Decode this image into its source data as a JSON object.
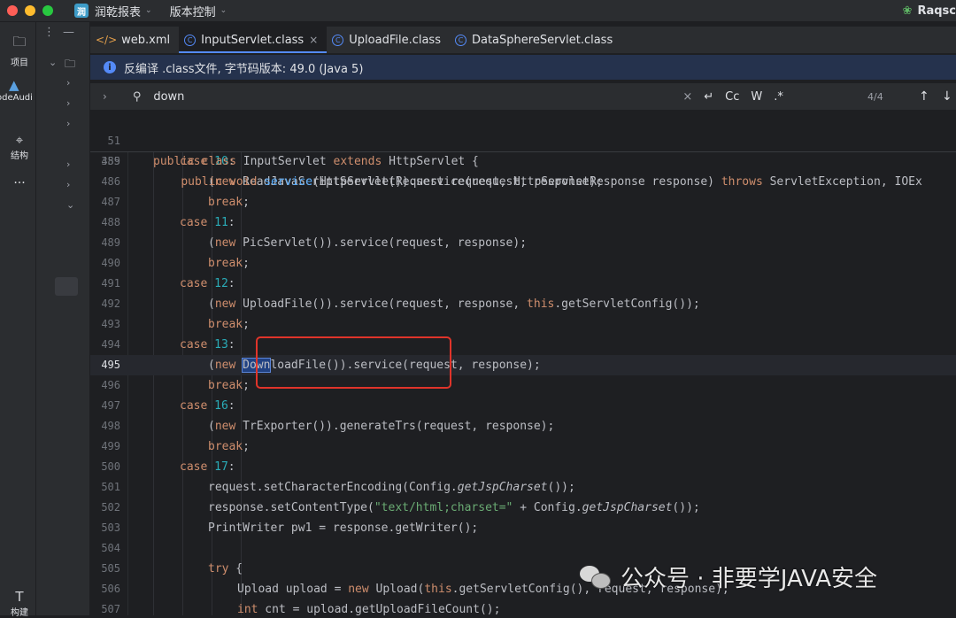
{
  "titlebar": {
    "project_badge": "润",
    "project_name": "润乾报表",
    "vcs_label": "版本控制",
    "user": "Raqsc"
  },
  "toolstrip": {
    "project_label": "项目",
    "codeaudit_label": "odeAudi",
    "structure_label": "结构",
    "more_label": "···",
    "build_label": "构建"
  },
  "tabs": [
    {
      "label": "web.xml",
      "icon": "xml-file-icon",
      "active": false
    },
    {
      "label": "InputServlet.class",
      "icon": "class-file-icon",
      "active": true
    },
    {
      "label": "UploadFile.class",
      "icon": "class-file-icon",
      "active": false
    },
    {
      "label": "DataSphereServlet.class",
      "icon": "class-file-icon",
      "active": false
    }
  ],
  "banner": {
    "text": "反编译 .class文件, 字节码版本: 49.0 (Java 5)"
  },
  "search": {
    "query": "down",
    "opt_case": "Cc",
    "opt_word": "W",
    "opt_regex": ".*",
    "match_count": "4/4"
  },
  "sticky_lines": [
    {
      "n": "51",
      "code": "public class InputServlet extends HttpServlet {"
    },
    {
      "n": "359",
      "code": "    public void service(HttpServletRequest request, HttpServletResponse response) throws ServletException, IOEx"
    }
  ],
  "code_lines": [
    {
      "n": "485",
      "code": "case 10:"
    },
    {
      "n": "486",
      "code": "(new ReadJavaScriptServlet()).service(request, response);"
    },
    {
      "n": "487",
      "code": "break;"
    },
    {
      "n": "488",
      "code": "case 11:"
    },
    {
      "n": "489",
      "code": "(new PicServlet()).service(request, response);"
    },
    {
      "n": "490",
      "code": "break;"
    },
    {
      "n": "491",
      "code": "case 12:"
    },
    {
      "n": "492",
      "code": "(new UploadFile()).service(request, response, this.getServletConfig());"
    },
    {
      "n": "493",
      "code": "break;"
    },
    {
      "n": "494",
      "code": "case 13:"
    },
    {
      "n": "495",
      "code": "(new DownloadFile()).service(request, response);"
    },
    {
      "n": "496",
      "code": "break;"
    },
    {
      "n": "497",
      "code": "case 16:"
    },
    {
      "n": "498",
      "code": "(new TrExporter()).generateTrs(request, response);"
    },
    {
      "n": "499",
      "code": "break;"
    },
    {
      "n": "500",
      "code": "case 17:"
    },
    {
      "n": "501",
      "code": "request.setCharacterEncoding(Config.getJspCharset());"
    },
    {
      "n": "502",
      "code": "response.setContentType(\"text/html;charset=\" + Config.getJspCharset());"
    },
    {
      "n": "503",
      "code": "PrintWriter pw1 = response.getWriter();"
    },
    {
      "n": "504",
      "code": ""
    },
    {
      "n": "505",
      "code": "try {"
    },
    {
      "n": "506",
      "code": "Upload upload = new Upload(this.getServletConfig(), request, response);"
    },
    {
      "n": "507",
      "code": "int cnt = upload.getUploadFileCount();"
    }
  ],
  "watermark": {
    "text": "公众号 · 非要学JAVA安全"
  },
  "colors": {
    "keyword": "#cf8e6d",
    "function": "#56a8f5",
    "number": "#2aacb8",
    "string": "#6aab73",
    "callout": "#e0342a",
    "accent": "#548af7"
  }
}
